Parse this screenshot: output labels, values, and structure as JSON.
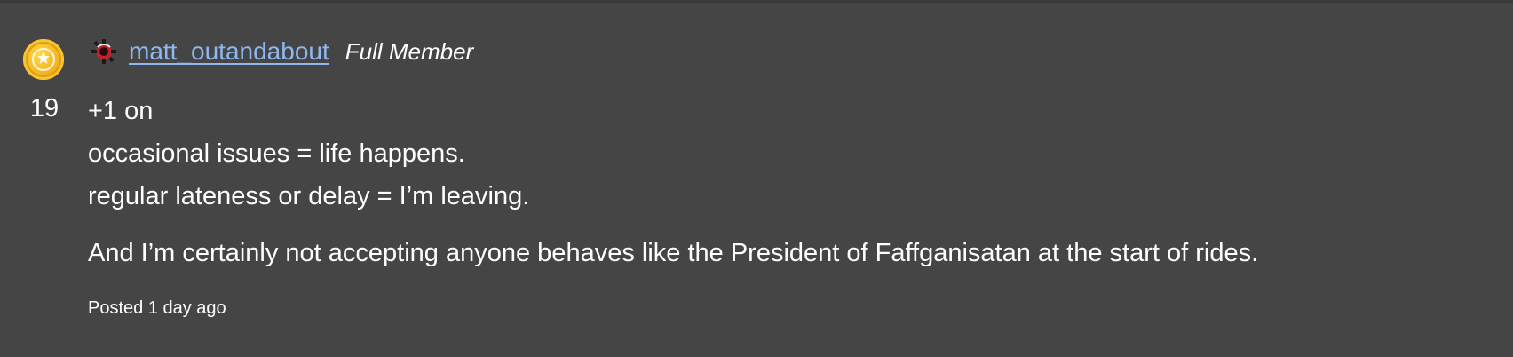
{
  "post": {
    "author": {
      "username": "matt_outandabout",
      "role": "Full Member",
      "avatar_icon": "avatar-emblem-icon",
      "rank_icon": "gold-rank-coin-icon"
    },
    "vote_count": "19",
    "content": {
      "lines": [
        "+1 on",
        "occasional issues = life happens.",
        "regular lateness or delay = I’m leaving."
      ],
      "paragraph": "And I’m certainly not accepting anyone behaves like the President of Faffganisatan at the start of rides."
    },
    "posted_label": "Posted 1 day ago"
  },
  "colors": {
    "background": "#454545",
    "username_link": "#8fb8f0",
    "text": "#ffffff",
    "rank_coin": "#f5b51c"
  }
}
